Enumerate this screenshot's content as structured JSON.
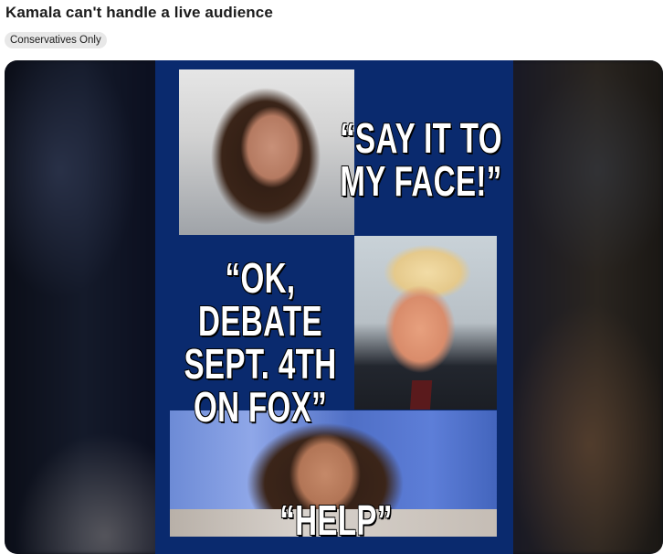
{
  "post": {
    "title": "Kamala can't handle a live audience",
    "flair": "Conservatives Only"
  },
  "meme": {
    "quote_1": "“SAY IT TO\nMY FACE!”",
    "quote_2": "“OK, DEBATE\nSEPT. 4TH\nON FOX”",
    "quote_3": "“HELP”",
    "background_color": "#0a2a6e"
  },
  "colors": {
    "title_text": "#1c1c1c",
    "flair_background": "#e8e8e8"
  }
}
